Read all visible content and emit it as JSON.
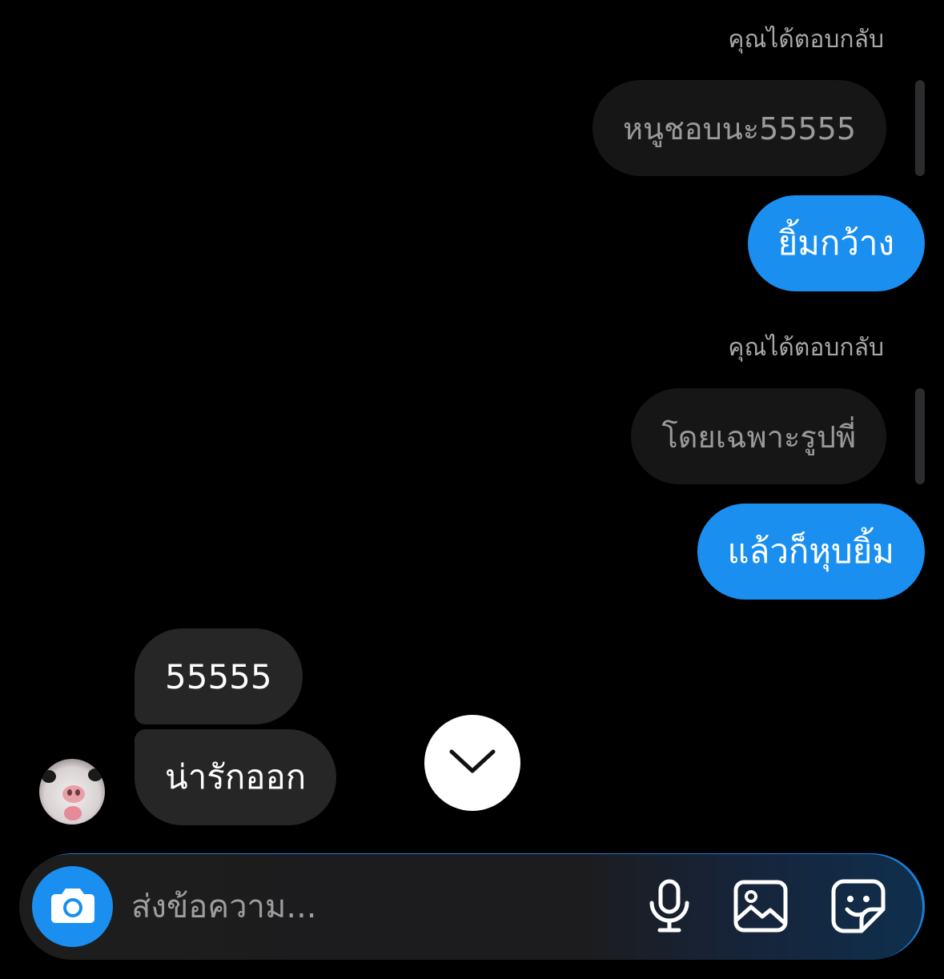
{
  "thread": {
    "reply_label": "คุณได้ตอบกลับ",
    "replies": [
      {
        "quoted": "หนูชอบนะ55555",
        "message": "ยิ้มกว้าง"
      },
      {
        "quoted": "โดยเฉพาะรูปพี่",
        "message": "แล้วก็หุบยิ้ม"
      }
    ],
    "received": [
      "55555",
      "น่ารักออก"
    ]
  },
  "composer": {
    "placeholder": "ส่งข้อความ..."
  },
  "icons": {
    "scroll_down": "chevron-down-icon",
    "camera": "camera-icon",
    "microphone": "microphone-icon",
    "gallery": "image-icon",
    "sticker": "sticker-icon"
  },
  "colors": {
    "background": "#000000",
    "sent_bubble": "#1a8ff0",
    "received_bubble": "#262626",
    "quoted_bubble": "#161616",
    "secondary_text": "#a8a8a8"
  }
}
